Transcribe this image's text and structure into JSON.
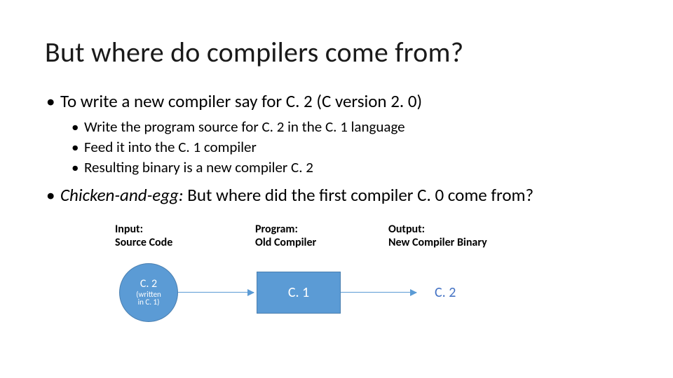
{
  "title": "But where do compilers come from?",
  "bullets": {
    "b1": "To write a new compiler say for C. 2  (C version 2. 0)",
    "b1a": "Write the program source for C. 2 in the C. 1 language",
    "b1b": "Feed it into the C. 1 compiler",
    "b1c": "Resulting binary is a new compiler C. 2",
    "b2_emph": "Chicken-and-egg:",
    "b2_rest": " But where did the first compiler C. 0 come from?"
  },
  "diagram": {
    "labels": {
      "input": "Input:\nSource Code",
      "program": "Program:\nOld Compiler",
      "output": "Output:\nNew Compiler Binary"
    },
    "nodes": {
      "circle_line1": "C. 2",
      "circle_line2": "(written",
      "circle_line3": "in C. 1)",
      "rect": "C. 1",
      "out": "C. 2"
    }
  },
  "colors": {
    "shapeFill": "#5b9bd5",
    "shapeBorder": "#4a7fb0",
    "outText": "#4472c4"
  }
}
